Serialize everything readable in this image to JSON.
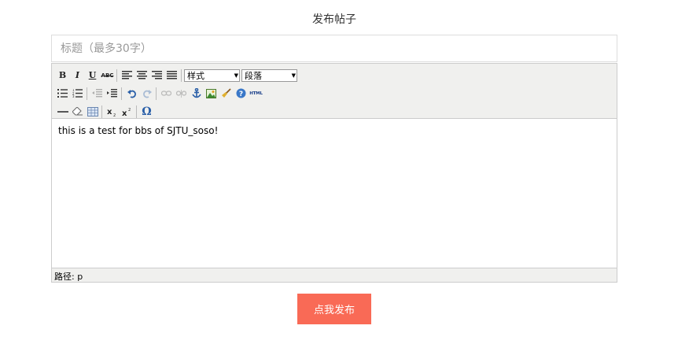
{
  "page": {
    "title": "发布帖子"
  },
  "title_field": {
    "placeholder": "标题（最多30字）",
    "value": ""
  },
  "editor": {
    "toolbar": {
      "bold": "B",
      "italic": "I",
      "underline": "U",
      "strikethrough": "ABC",
      "style_select": "样式",
      "format_select": "段落",
      "html": "HTML",
      "omega": "Ω"
    },
    "content": "this is a test for bbs of SJTU_soso!",
    "status": {
      "label": "路径:",
      "path": "p"
    }
  },
  "submit": {
    "label": "点我发布",
    "color": "#f96a56"
  }
}
